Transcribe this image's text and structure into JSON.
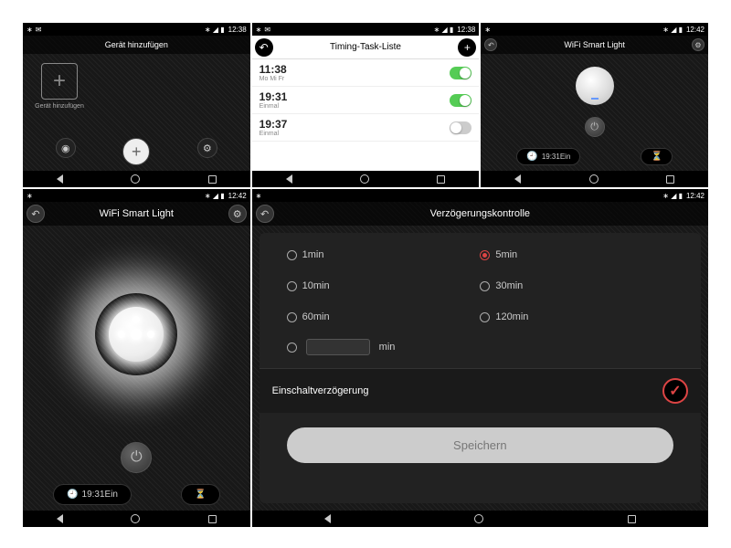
{
  "status": {
    "time": "12:38",
    "time2": "12:42",
    "bt": "∗",
    "sig": "◢",
    "bat": "▮"
  },
  "screen1": {
    "title": "Gerät hinzufügen",
    "tile_label": "Gerät hinzufügen"
  },
  "screen2": {
    "title": "Timing-Task-Liste",
    "items": [
      {
        "time": "11:38",
        "sub": "Mo Mi Fr",
        "on": true
      },
      {
        "time": "19:31",
        "sub": "Einmal",
        "on": true
      },
      {
        "time": "19:37",
        "sub": "Einmal",
        "on": false
      }
    ]
  },
  "screen3": {
    "title": "WiFi Smart Light",
    "pill_time": "19:31Ein"
  },
  "screen4": {
    "title": "WiFi Smart Light",
    "pill_time": "19:31Ein"
  },
  "screen5": {
    "title": "Verzögerungskontrolle",
    "options": [
      "1min",
      "5min",
      "10min",
      "30min",
      "60min",
      "120min"
    ],
    "selected": 1,
    "custom_unit": "min",
    "status_label": "Einschaltverzögerung",
    "save": "Speichern"
  }
}
